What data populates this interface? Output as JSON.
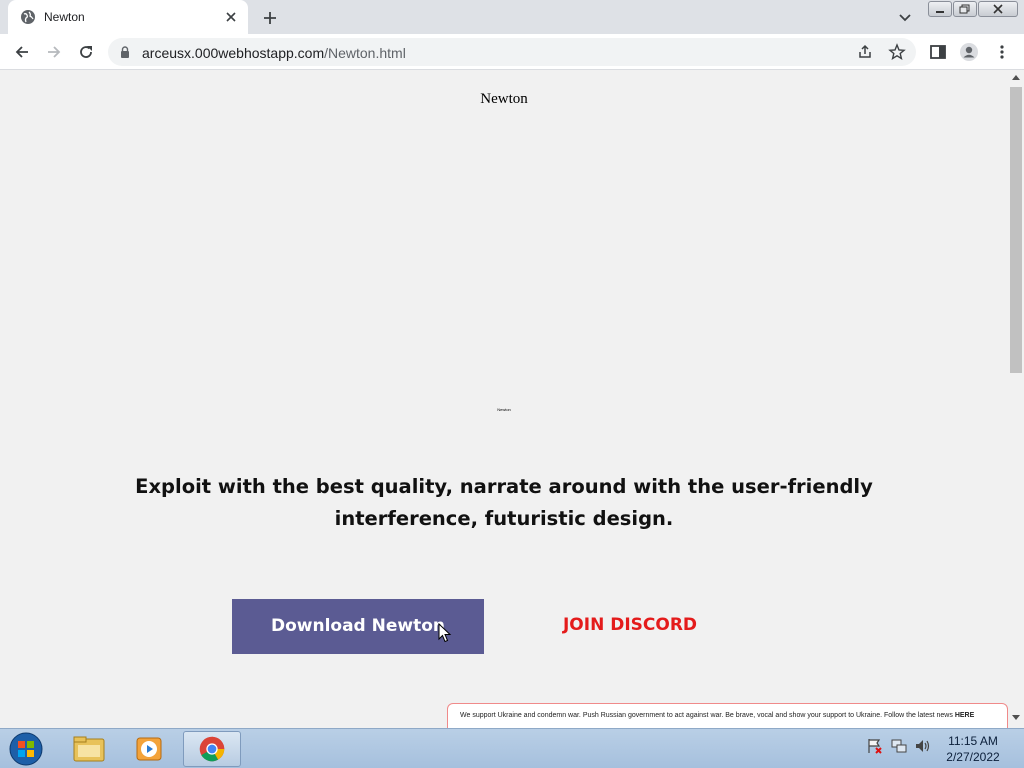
{
  "browser": {
    "tab_title": "Newton",
    "url_host": "arceusx.000webhostapp.com",
    "url_path": "/Newton.html"
  },
  "page": {
    "site_title": "Newton",
    "logo_text": "Newton",
    "headline": "Exploit with the best quality, narrate around with the user-friendly interference, futuristic design.",
    "download_label": "Download Newton",
    "discord_label": "JOIN DISCORD",
    "banner_text": "We support Ukraine and condemn war. Push Russian government to act against war. Be brave, vocal and show your support to Ukraine. Follow the latest news",
    "banner_link": "HERE"
  },
  "taskbar": {
    "time": "11:15 AM",
    "date": "2/27/2022"
  },
  "colors": {
    "download_button": "#5b5b93",
    "discord_link": "#e41b1b",
    "page_bg": "#f1f1f1"
  }
}
